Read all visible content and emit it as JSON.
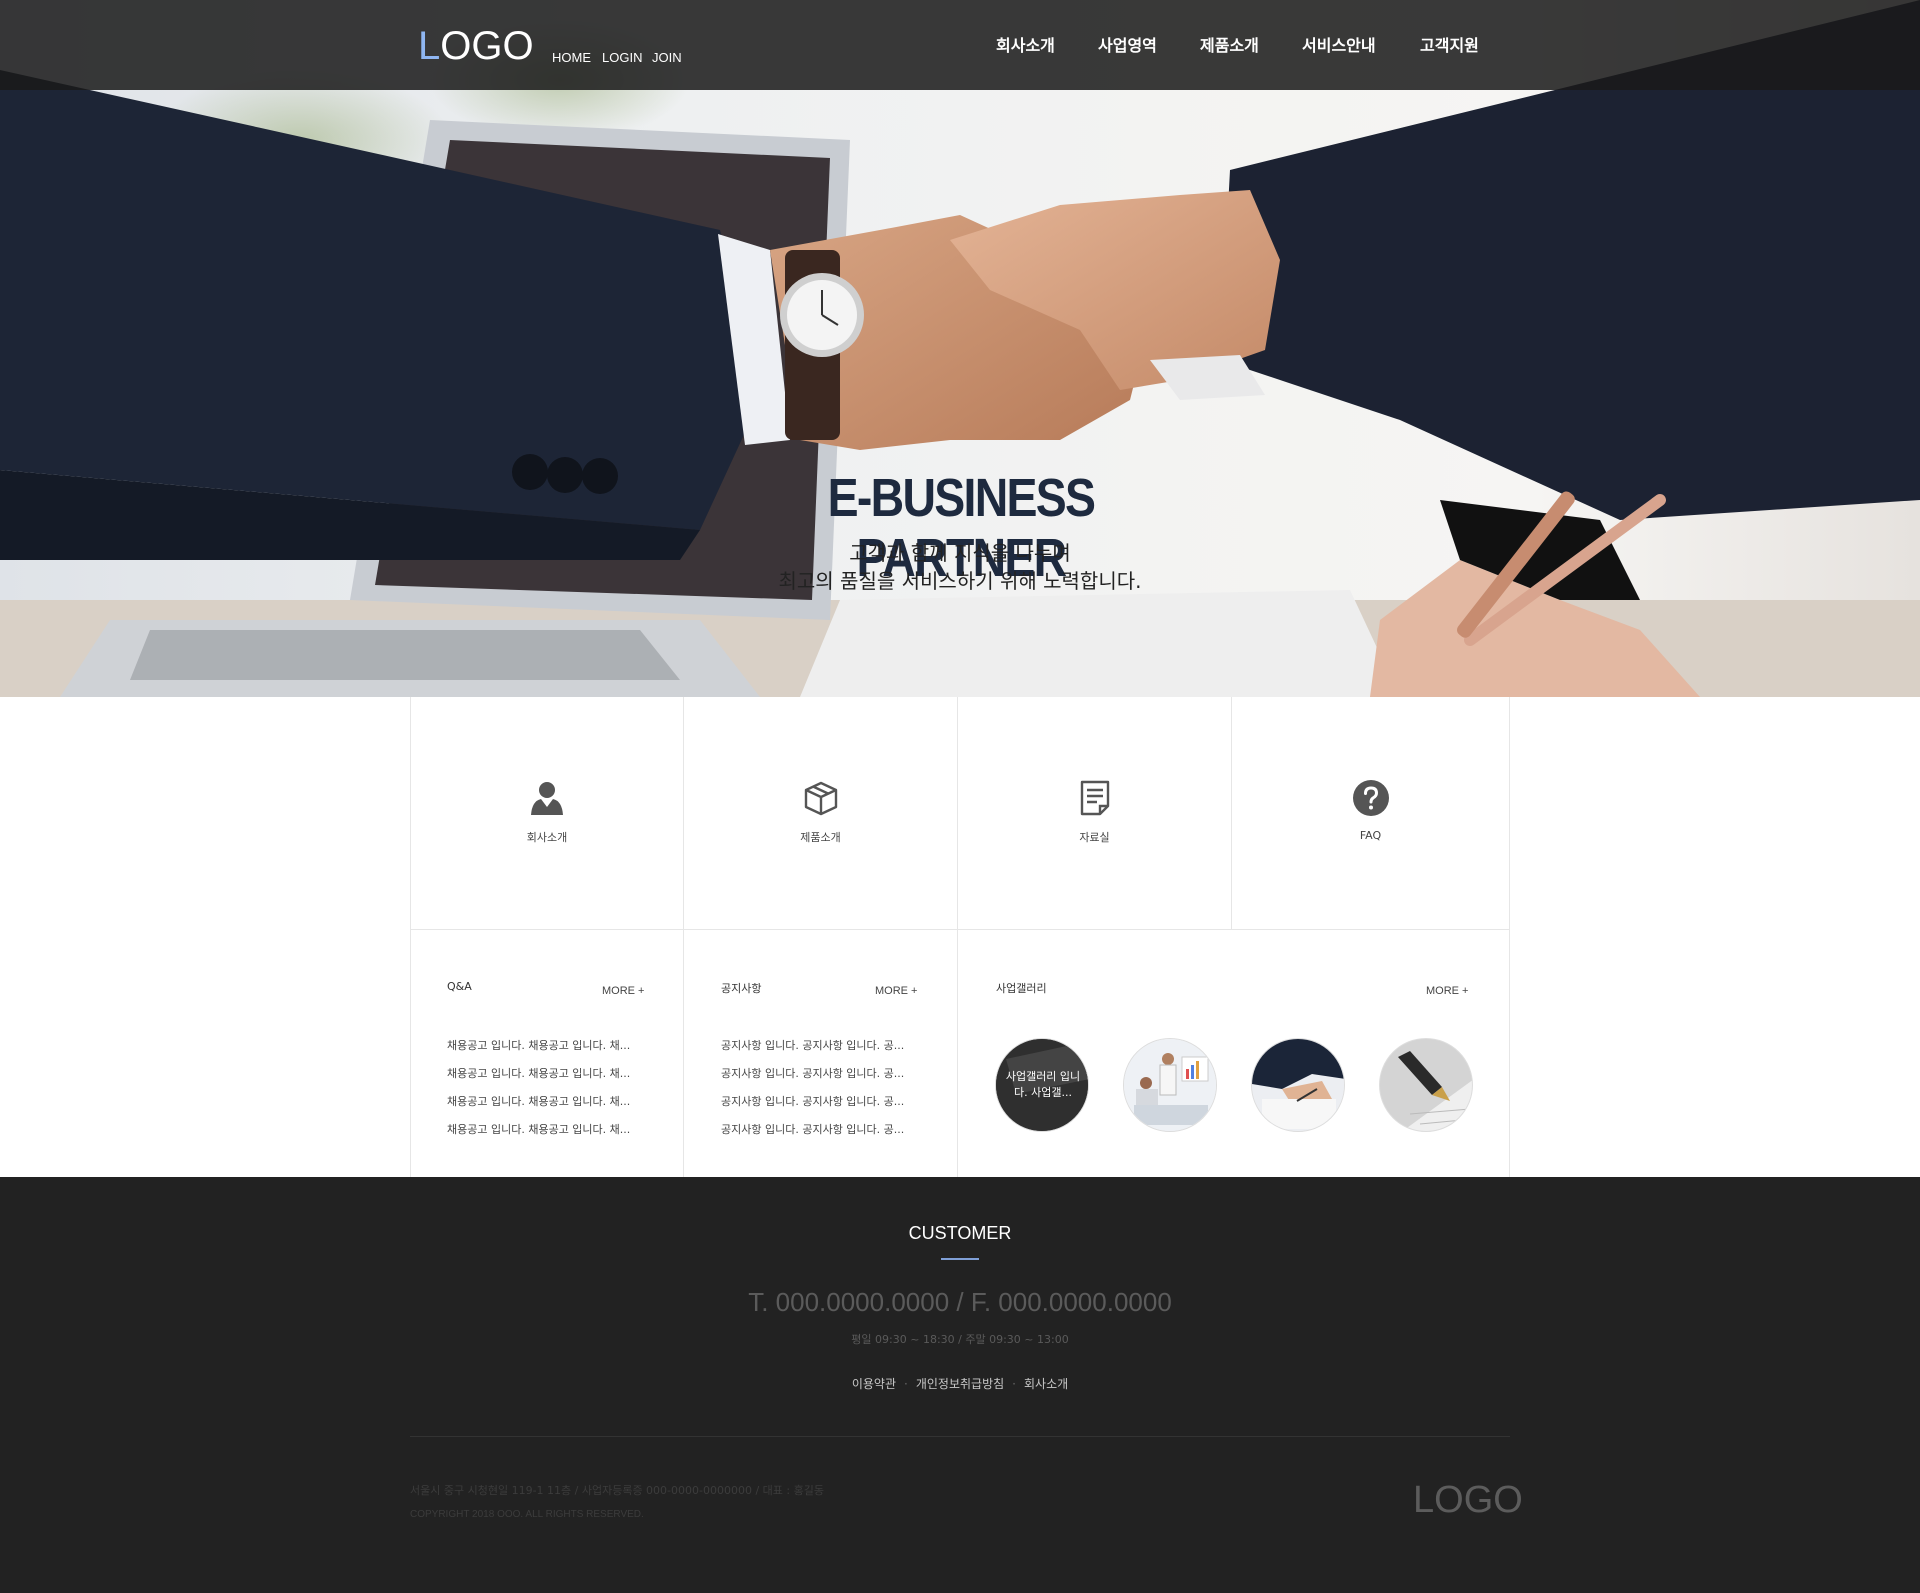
{
  "header": {
    "logo_first": "L",
    "logo_rest": "OGO",
    "util": [
      "HOME",
      "LOGIN",
      "JOIN"
    ],
    "nav": [
      "회사소개",
      "사업영역",
      "제품소개",
      "서비스안내",
      "고객지원"
    ]
  },
  "hero": {
    "title": "E-BUSINESS PARTNER",
    "sub1": "고객과 함께 지식을 나누며",
    "sub2": "최고의 품질을 서비스하기 위해 노력합니다."
  },
  "quick": [
    {
      "label": "회사소개",
      "icon": "person-icon"
    },
    {
      "label": "제품소개",
      "icon": "box-icon"
    },
    {
      "label": "자료실",
      "icon": "document-icon"
    },
    {
      "label": "FAQ",
      "icon": "question-icon"
    }
  ],
  "qna": {
    "title": "Q&A",
    "more": "MORE +",
    "items": [
      "채용공고 입니다. 채용공고 입니다. 채...",
      "채용공고 입니다. 채용공고 입니다. 채...",
      "채용공고 입니다. 채용공고 입니다. 채...",
      "채용공고 입니다. 채용공고 입니다. 채..."
    ]
  },
  "notice": {
    "title": "공지사항",
    "more": "MORE +",
    "items": [
      "공지사항 입니다. 공지사항 입니다. 공...",
      "공지사항 입니다. 공지사항 입니다. 공...",
      "공지사항 입니다. 공지사항 입니다. 공...",
      "공지사항 입니다. 공지사항 입니다. 공..."
    ]
  },
  "gallery": {
    "title": "사업갤러리",
    "more": "MORE +",
    "first_caption": "사업갤러리 입니다. 사업갤..."
  },
  "footer": {
    "title": "CUSTOMER",
    "phone": "T. 000.0000.0000 / F. 000.0000.0000",
    "hours": "평일 09:30 ~ 18:30 / 주말 09:30 ~ 13:00",
    "links": [
      "이용약관",
      "개인정보취급방침",
      "회사소개"
    ],
    "address": "서울시 중구 시청현일 119-1 11층 / 사업자등록증 000-0000-0000000 / 대표 : 홍길동",
    "copyright": "COPYRIGHT 2018 OOO. ALL RIGHTS RESERVED.",
    "logo": "LOGO"
  },
  "colors": {
    "header_bg": "#1a1a1a",
    "logo_accent": "#8fb6f2",
    "hero_title": "#1e2a3f",
    "footer_bg": "#222222",
    "footer_accent": "#7f9fd6"
  }
}
